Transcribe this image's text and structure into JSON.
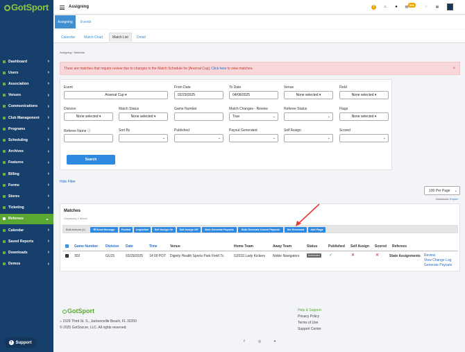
{
  "app": {
    "logo_text": "GotSport",
    "page_title": "Assigning"
  },
  "topbar": {
    "badge": "999",
    "icons": [
      "help-icon",
      "home-icon",
      "user-icon",
      "mail-icon",
      "chat-icon",
      "gear-icon"
    ]
  },
  "sidebar": {
    "items": [
      {
        "label": "Dashboard"
      },
      {
        "label": "Users"
      },
      {
        "label": "Association"
      },
      {
        "label": "Venues"
      },
      {
        "label": "Communications"
      },
      {
        "label": "Club Management"
      },
      {
        "label": "Programs"
      },
      {
        "label": "Scheduling"
      },
      {
        "label": "Archives"
      },
      {
        "label": "Features"
      },
      {
        "label": "Billing"
      },
      {
        "label": "Forms"
      },
      {
        "label": "Stores"
      },
      {
        "label": "Ticketing"
      },
      {
        "label": "Referees"
      },
      {
        "label": "Calendar"
      },
      {
        "label": "Saved Reports"
      },
      {
        "label": "Downloads"
      },
      {
        "label": "Demos"
      }
    ],
    "active_index": 14,
    "support_label": "Support"
  },
  "tabs_primary": [
    {
      "label": "Assigning"
    },
    {
      "label": "Events"
    }
  ],
  "tabs_secondary": [
    {
      "label": "Calendar"
    },
    {
      "label": "Match Chart"
    },
    {
      "label": "Match List"
    },
    {
      "label": "Detail"
    }
  ],
  "breadcrumb": {
    "a": "Assigning",
    "sep": "›",
    "b": "Matches"
  },
  "alert": {
    "text_before": "There are matches that require review due to changes in the Match Schedule for [Arsenal Cup].",
    "link": "Click here",
    "text_after": "to view matches.",
    "close": "×"
  },
  "filters": {
    "event": {
      "label": "Event",
      "value": "Arsenal Cup"
    },
    "from_date": {
      "label": "From Date",
      "value": "02/23/2025"
    },
    "to_date": {
      "label": "To Date",
      "value": "04/06/2025"
    },
    "venue": {
      "label": "Venue",
      "value": "None selected"
    },
    "field": {
      "label": "Field",
      "value": "None selected"
    },
    "division": {
      "label": "Division",
      "value": "None selected"
    },
    "match_status": {
      "label": "Match Status",
      "value": "None selected"
    },
    "game_number": {
      "label": "Game Number",
      "value": ""
    },
    "match_changes": {
      "label": "Match Changes - Review",
      "value": "True"
    },
    "referee_status": {
      "label": "Referee Status",
      "value": ""
    },
    "flags": {
      "label": "Flags",
      "value": "None selected"
    },
    "referee_name": {
      "label": "Referee Name",
      "value": ""
    },
    "sort_by": {
      "label": "Sort By",
      "value": ""
    },
    "published": {
      "label": "Published",
      "value": ""
    },
    "payout_generated": {
      "label": "Payout Generated",
      "value": ""
    },
    "self_assign": {
      "label": "Self Assign",
      "value": ""
    },
    "scored": {
      "label": "Scored",
      "value": ""
    },
    "search_label": "Search"
  },
  "hide_filter": "Hide Filter",
  "per_page": "100 Per Page",
  "download": {
    "label": "Download:",
    "link": "Export"
  },
  "matches": {
    "title": "Matches",
    "count_text": "Displaying 1 Match",
    "bulk_label": "Bulk Actions (1)",
    "bulk_buttons": [
      "Send Message",
      "Publish",
      "Unpublish",
      "Self Assign On",
      "Self Assign Off",
      "Bulk Generate Payouts",
      "Bulk Generate Cancel Payouts",
      "Set Reviewed",
      "Add Flags"
    ],
    "headers": [
      "Game Number",
      "Division",
      "Date",
      "Time",
      "Venue",
      "Home Team",
      "Away Team",
      "Status",
      "Published",
      "Self Assign",
      "Scored",
      "Referees"
    ],
    "rows": [
      {
        "game_number": "302",
        "division": "GU15",
        "date": "03/29/2025",
        "time": "14:00 PDT",
        "venue": "Dignity Health Sports Park Field 7c",
        "home_team": "G2010 Lady Kickers",
        "away_team": "Noble Navigators",
        "status": "Scheduled",
        "published": "✓",
        "self_assign": "✕",
        "scored": "✕",
        "referees": "State Assignments",
        "actions": [
          "Review",
          "View Change Log",
          "Generate Payouts"
        ]
      }
    ]
  },
  "footer": {
    "logo": "GotSport",
    "address": "1529 Third St. S., Jacksonville Beach, FL 32250",
    "copyright": "© 2025 GotSoccer, LLC. All rights reserved.",
    "links": [
      "Help & Support",
      "Privacy Policy",
      "Terms of Use",
      "Support Center"
    ]
  },
  "colors": {
    "sidebar": "#173f6b",
    "accent_green": "#5aa832",
    "primary_blue": "#2d8ae0",
    "alert_bg": "#f8d7da",
    "arrow": "#e53935"
  }
}
